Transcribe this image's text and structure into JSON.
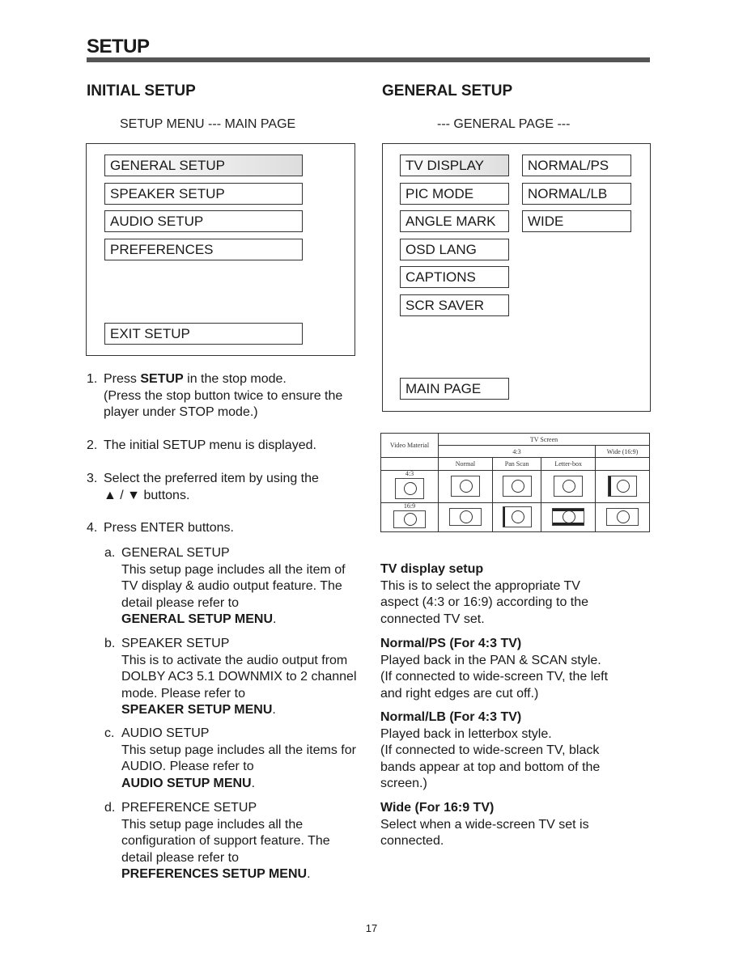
{
  "page": {
    "title": "SETUP",
    "page_number": "17"
  },
  "initial_setup": {
    "heading": "INITIAL SETUP",
    "subheading": "SETUP MENU --- MAIN PAGE",
    "menu_items": [
      "GENERAL SETUP",
      "SPEAKER SETUP",
      "AUDIO SETUP",
      "PREFERENCES"
    ],
    "exit_item": "EXIT SETUP",
    "steps": [
      {
        "num": "1.",
        "bold": "SETUP",
        "pre": "Press ",
        "post": " in the stop mode.",
        "extra": "(Press the stop button twice to ensure the player under STOP mode.)"
      },
      {
        "num": "2.",
        "text": "The initial SETUP menu is displayed."
      },
      {
        "num": "3.",
        "text": "Select the preferred item by using the",
        "text2": "▲ / ▼ buttons."
      },
      {
        "num": "4.",
        "text": "Press ENTER buttons."
      }
    ],
    "subitems": [
      {
        "letter": "a.",
        "title": "GENERAL SETUP",
        "desc": "This setup page includes all the item of TV display & audio output feature.  The detail please refer to",
        "ref": "GENERAL SETUP MENU"
      },
      {
        "letter": "b.",
        "title": "SPEAKER SETUP",
        "desc": "This is to activate the audio output from DOLBY AC3 5.1 DOWNMIX to 2 channel mode.  Please refer to",
        "ref": "SPEAKER SETUP MENU"
      },
      {
        "letter": "c.",
        "title": "AUDIO SETUP",
        "desc": "This setup page includes all the items for AUDIO.  Please refer to",
        "ref": "AUDIO SETUP MENU"
      },
      {
        "letter": "d.",
        "title": "PREFERENCE SETUP",
        "desc": "This setup page includes all the configuration of support feature. The detail please refer to",
        "ref": "PREFERENCES SETUP MENU"
      }
    ]
  },
  "general_setup": {
    "heading": "GENERAL SETUP",
    "subheading": "--- GENERAL PAGE ---",
    "menu_items": [
      "TV DISPLAY",
      "PIC MODE",
      "ANGLE MARK",
      "OSD LANG",
      "CAPTIONS",
      "SCR SAVER"
    ],
    "options": [
      "NORMAL/PS",
      "NORMAL/LB",
      "WIDE"
    ],
    "main_page_item": "MAIN PAGE",
    "table": {
      "video_material": "Video Material",
      "tv_screen": "TV Screen",
      "group_43": "4:3",
      "group_wide": "Wide (16:9)",
      "cols": [
        "Normal",
        "Pan Scan",
        "Letter-box"
      ],
      "row_labels": [
        "4:3",
        "16:9"
      ]
    },
    "sections": [
      {
        "title": "TV display setup",
        "lines": [
          "This is to select the appropriate TV",
          "aspect (4:3 or 16:9) according to the",
          "connected TV set."
        ]
      },
      {
        "title": "Normal/PS (For 4:3 TV)",
        "lines": [
          "Played back in the PAN & SCAN style.",
          "(If connected to wide-screen TV, the left",
          "and right edges are cut off.)"
        ]
      },
      {
        "title": "Normal/LB (For 4:3 TV)",
        "lines": [
          "Played back in letterbox style.",
          "(If connected to wide-screen TV, black",
          "bands appear at top and bottom of the",
          "screen.)"
        ]
      },
      {
        "title": "Wide (For 16:9 TV)",
        "lines": [
          "Select when a wide-screen TV set is",
          "connected."
        ]
      }
    ]
  }
}
